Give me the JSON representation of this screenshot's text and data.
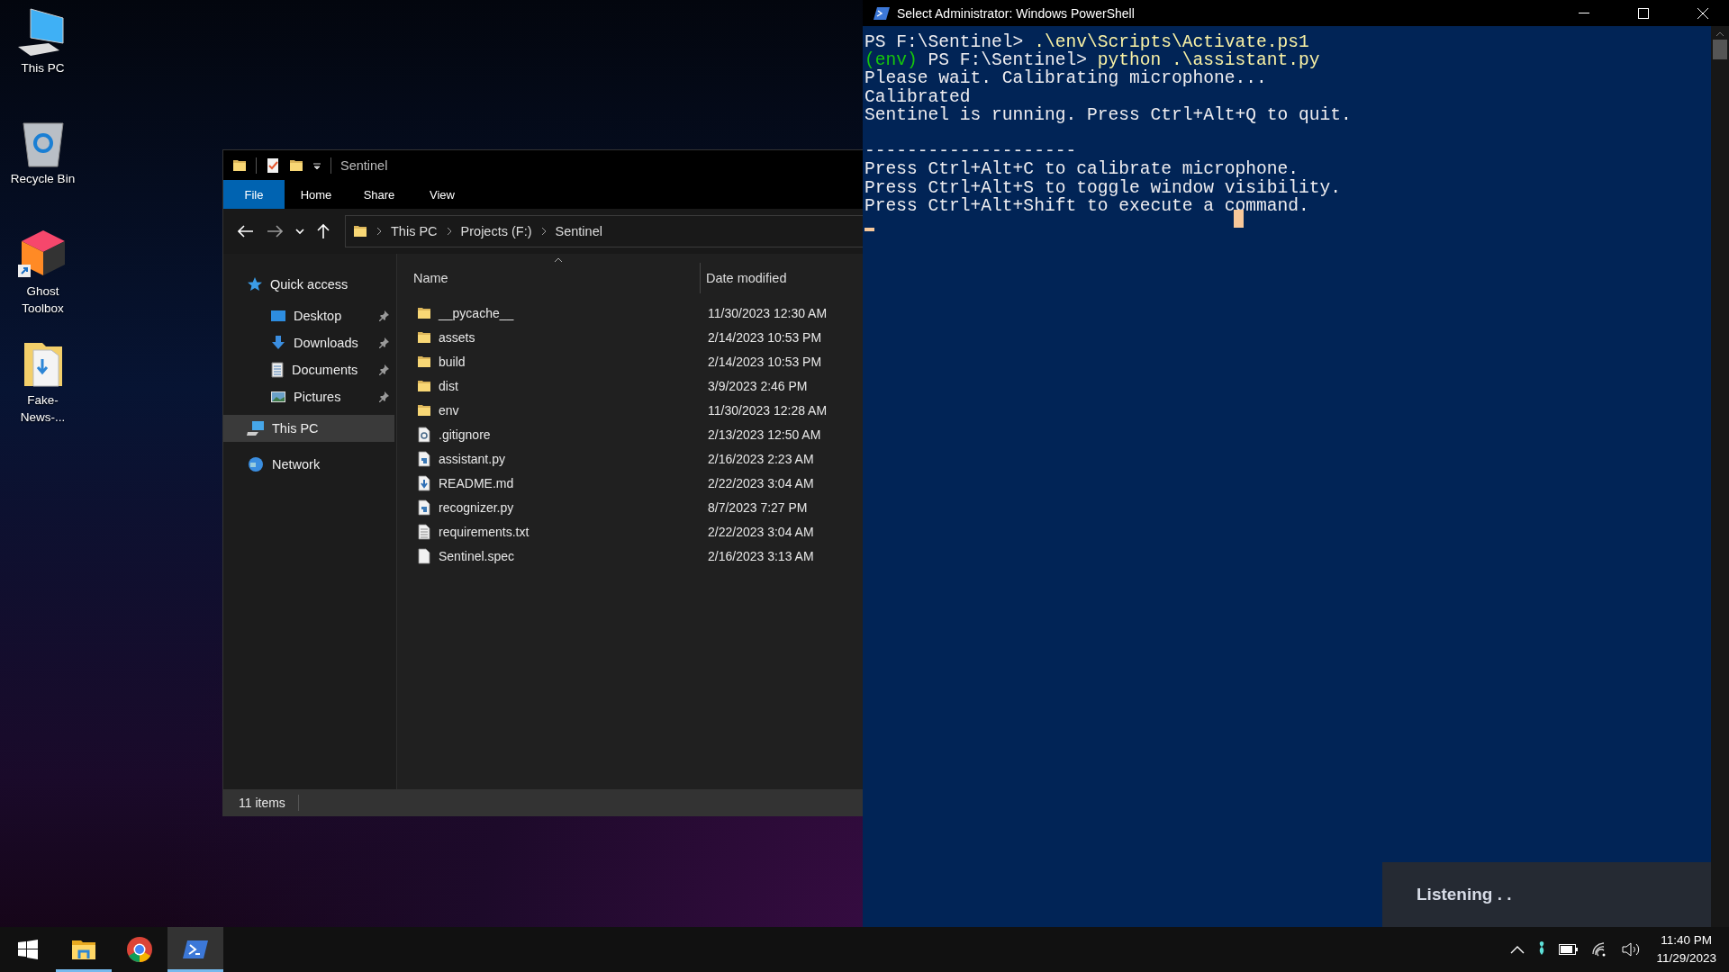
{
  "desktop_icons": [
    {
      "label": "This PC",
      "kind": "computer"
    },
    {
      "label": "Recycle Bin",
      "kind": "recycle-bin"
    },
    {
      "label": "Ghost Toolbox",
      "kind": "app-shortcut"
    },
    {
      "label": "Fake-News-...",
      "kind": "folder"
    }
  ],
  "explorer": {
    "title": "Sentinel",
    "ribbon_tabs": [
      {
        "label": "File",
        "kind": "file-menu"
      },
      {
        "label": "Home",
        "kind": "tab"
      },
      {
        "label": "Share",
        "kind": "tab"
      },
      {
        "label": "View",
        "kind": "tab"
      }
    ],
    "breadcrumb": [
      "This PC",
      "Projects (F:)",
      "Sentinel"
    ],
    "sidebar": {
      "items": [
        {
          "label": "Quick access",
          "kind": "star",
          "selected": false,
          "children": [
            {
              "label": "Desktop",
              "kind": "desktop",
              "selected": false,
              "pinned": true
            },
            {
              "label": "Downloads",
              "kind": "downloads",
              "selected": false,
              "pinned": true
            },
            {
              "label": "Documents",
              "kind": "documents",
              "selected": false,
              "pinned": true
            },
            {
              "label": "Pictures",
              "kind": "pictures",
              "selected": false,
              "pinned": true
            }
          ]
        },
        {
          "label": "This PC",
          "kind": "computer",
          "selected": true
        },
        {
          "label": "Network",
          "kind": "network",
          "selected": false
        }
      ]
    },
    "columns": [
      {
        "label": "Name",
        "sorted": true
      },
      {
        "label": "Date modified",
        "sorted": false
      }
    ],
    "files": [
      {
        "name": "__pycache__",
        "date": "11/30/2023 12:30 AM",
        "kind": "folder"
      },
      {
        "name": "assets",
        "date": "2/14/2023 10:53 PM",
        "kind": "folder"
      },
      {
        "name": "build",
        "date": "2/14/2023 10:53 PM",
        "kind": "folder"
      },
      {
        "name": "dist",
        "date": "3/9/2023 2:46 PM",
        "kind": "folder"
      },
      {
        "name": "env",
        "date": "11/30/2023 12:28 AM",
        "kind": "folder"
      },
      {
        "name": ".gitignore",
        "date": "2/13/2023 12:50 AM",
        "kind": "settings"
      },
      {
        "name": "assistant.py",
        "date": "2/16/2023 2:23 AM",
        "kind": "python"
      },
      {
        "name": "README.md",
        "date": "2/22/2023 3:04 AM",
        "kind": "markdown"
      },
      {
        "name": "recognizer.py",
        "date": "8/7/2023 7:27 PM",
        "kind": "python"
      },
      {
        "name": "requirements.txt",
        "date": "2/22/2023 3:04 AM",
        "kind": "text"
      },
      {
        "name": "Sentinel.spec",
        "date": "2/16/2023 3:13 AM",
        "kind": "blank"
      }
    ],
    "status_bar": {
      "items": "11 items"
    }
  },
  "powershell": {
    "title": "Select Administrator: Windows PowerShell",
    "lines": [
      {
        "kind": "text",
        "segments": [
          {
            "text": "PS F:\\Sentinel> ",
            "kind": "prompt"
          },
          {
            "text": ".\\env\\Scripts\\Activate.ps1",
            "kind": "command"
          }
        ]
      },
      {
        "kind": "text",
        "segments": [
          {
            "text": "(env)",
            "kind": "env"
          },
          {
            "text": " PS F:\\Sentinel> ",
            "kind": "prompt"
          },
          {
            "text": "python .\\assistant.py",
            "kind": "command"
          }
        ]
      },
      {
        "kind": "text",
        "segments": [
          {
            "text": "Please wait. Calibrating microphone...",
            "kind": "output"
          }
        ]
      },
      {
        "kind": "text",
        "segments": [
          {
            "text": "Calibrated",
            "kind": "output"
          }
        ]
      },
      {
        "kind": "text",
        "segments": [
          {
            "text": "Sentinel is running. Press Ctrl+Alt+Q to quit.",
            "kind": "output"
          }
        ]
      },
      {
        "kind": "blank"
      },
      {
        "kind": "text",
        "segments": [
          {
            "text": "--------------------",
            "kind": "output"
          }
        ]
      },
      {
        "kind": "text",
        "segments": [
          {
            "text": "Press Ctrl+Alt+C to calibrate microphone.",
            "kind": "output"
          }
        ]
      },
      {
        "kind": "text",
        "segments": [
          {
            "text": "Press Ctrl+Alt+S to toggle window visibility.",
            "kind": "output"
          }
        ]
      },
      {
        "kind": "text",
        "segments": [
          {
            "text": "Press Ctrl+Alt+Shift to execute a command.",
            "kind": "output"
          }
        ]
      }
    ]
  },
  "toast": {
    "text": "Listening . ."
  },
  "taskbar": {
    "apps": [
      {
        "kind": "start",
        "running": false,
        "active": false
      },
      {
        "kind": "explorer",
        "running": true,
        "active": false
      },
      {
        "kind": "browser",
        "running": false,
        "active": false
      },
      {
        "kind": "powershell",
        "running": true,
        "active": true
      }
    ],
    "time": "11:40 PM",
    "date": "11/29/2023"
  }
}
